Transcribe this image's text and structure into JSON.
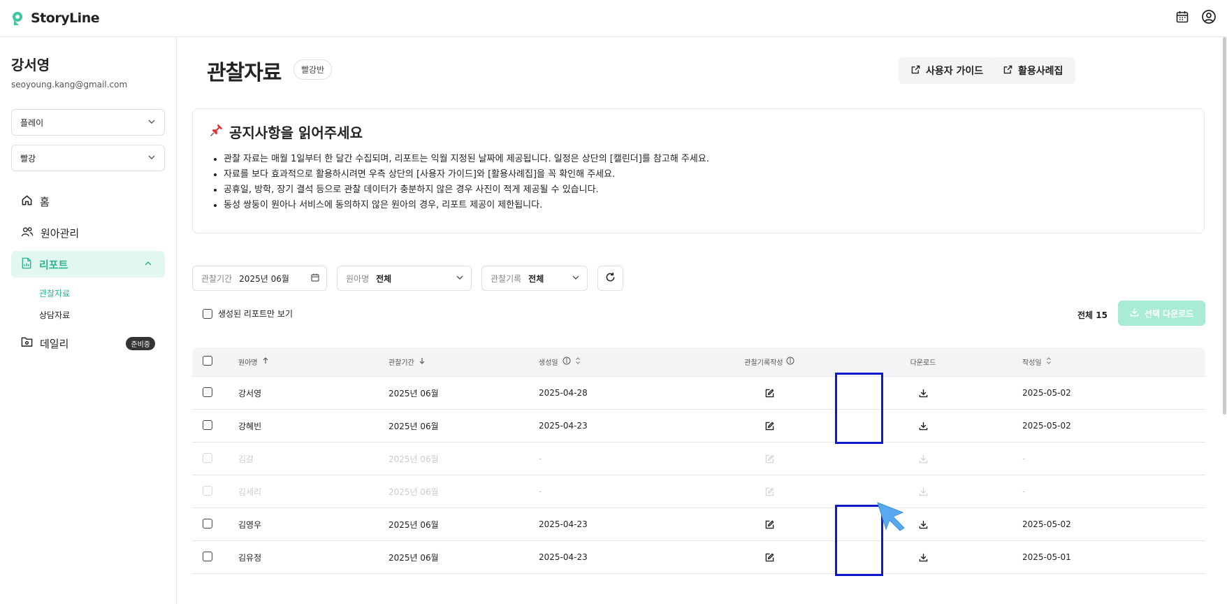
{
  "app": {
    "name": "StoryLine"
  },
  "user": {
    "name": "강서영",
    "email": "seoyoung.kang@gmail.com"
  },
  "sidebar": {
    "select_1": "플레이",
    "select_2": "빨강",
    "nav": {
      "home": "홈",
      "children": "원아관리",
      "report": "리포트",
      "report_sub_1": "관찰자료",
      "report_sub_2": "상담자료",
      "daily": "데일리",
      "daily_badge": "준비중"
    }
  },
  "page": {
    "title": "관찰자료",
    "class_chip": "빨강반",
    "guide_button": "사용자 가이드",
    "cases_button": "활용사례집"
  },
  "notice": {
    "title": "공지사항을 읽어주세요",
    "items": [
      "관찰 자료는 매월 1일부터 한 달간 수집되며, 리포트는 익월 지정된 날짜에 제공됩니다. 일정은 상단의 [캘린더]를 참고해 주세요.",
      "자료를 보다 효과적으로 활용하시려면 우측 상단의 [사용자 가이드]와 [활용사례집]을 꼭 확인해 주세요.",
      "공휴일, 방학, 장기 결석 등으로 관찰 데이터가 충분하지 않은 경우 사진이 적게 제공될 수 있습니다.",
      "동성 쌍둥이 원아나 서비스에 동의하지 않은 원아의 경우, 리포트 제공이 제한됩니다."
    ]
  },
  "filters": {
    "period_label": "관찰기간",
    "period_value": "2025년 06월",
    "child_label": "원아명",
    "child_value": "전체",
    "record_label": "관찰기록",
    "record_value": "전체"
  },
  "only_generated_label": "생성된 리포트만 보기",
  "total_label": "전체 15",
  "download_selected_label": "선택 다운로드",
  "table": {
    "headers": {
      "name": "원아명",
      "period": "관찰기간",
      "created": "생성일",
      "record": "관찰기록작성",
      "download": "다운로드",
      "written": "작성일"
    },
    "rows": [
      {
        "name": "강서영",
        "period": "2025년 06월",
        "created": "2025-04-28",
        "written": "2025-05-02",
        "disabled": false
      },
      {
        "name": "강혜빈",
        "period": "2025년 06월",
        "created": "2025-04-23",
        "written": "2025-05-02",
        "disabled": false
      },
      {
        "name": "김갈",
        "period": "2025년 06월",
        "created": "-",
        "written": "-",
        "disabled": true
      },
      {
        "name": "김세리",
        "period": "2025년 06월",
        "created": "-",
        "written": "-",
        "disabled": true
      },
      {
        "name": "김영우",
        "period": "2025년 06월",
        "created": "2025-04-23",
        "written": "2025-05-02",
        "disabled": false
      },
      {
        "name": "김유정",
        "period": "2025년 06월",
        "created": "2025-04-23",
        "written": "2025-05-01",
        "disabled": false
      }
    ]
  },
  "colors": {
    "accent": "#2bb48f",
    "highlight": "#1118c9"
  }
}
